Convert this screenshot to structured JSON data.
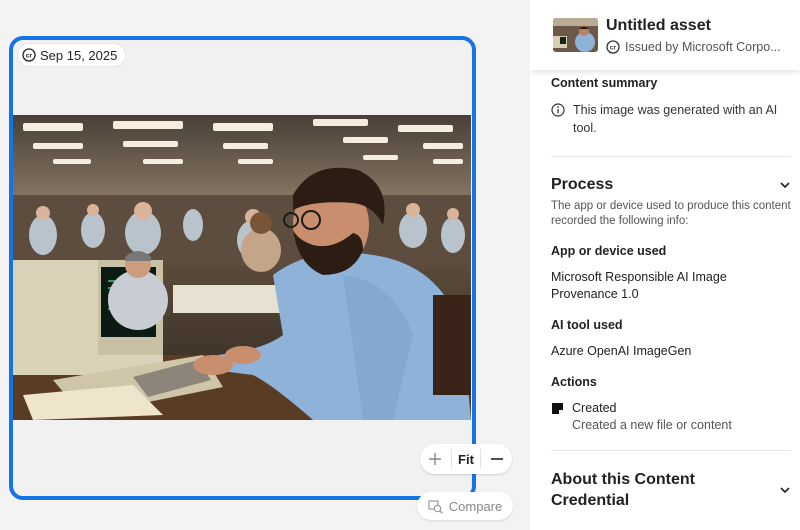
{
  "canvas": {
    "date_label": "Sep 15, 2025",
    "zoom_in_symbol": "+",
    "fit_label": "Fit",
    "zoom_out_symbol": "—",
    "compare_label": "Compare"
  },
  "panel": {
    "title": "Untitled asset",
    "issuer": "Issued by Microsoft Corpo...",
    "content_summary_label": "Content summary",
    "content_summary_text": "This image was generated with an AI tool.",
    "process": {
      "title": "Process",
      "description": "The app or device used to produce this content recorded the following info:",
      "app_label": "App or device used",
      "app_value": "Microsoft Responsible AI Image Provenance 1.0",
      "ai_tool_label": "AI tool used",
      "ai_tool_value": "Azure OpenAI ImageGen",
      "actions_label": "Actions",
      "action_title": "Created",
      "action_desc": "Created a new file or content"
    },
    "about": {
      "title": "About this Content Credential"
    }
  },
  "colors": {
    "accent": "#1473e6",
    "panel_bg": "#ffffff",
    "canvas_bg": "#f3f3f3"
  },
  "icons": [
    "content-credentials-icon",
    "info-icon",
    "chevron-down-icon",
    "created-icon",
    "plus-icon",
    "minus-icon",
    "compare-icon"
  ]
}
